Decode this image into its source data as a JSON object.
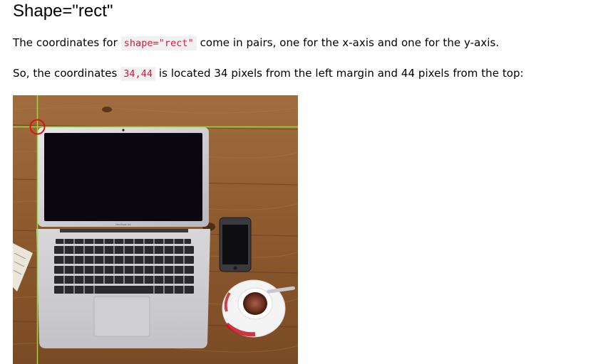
{
  "heading": "Shape=\"rect\"",
  "paragraph1": {
    "before": "The coordinates for ",
    "code": "shape=\"rect\"",
    "after": " come in pairs, one for the x-axis and one for the y-axis."
  },
  "paragraph2": {
    "before": "So, the coordinates ",
    "code": "34,44",
    "after": " is located 34 pixels from the left margin and 44 pixels from the top:"
  },
  "image": {
    "laptop_brand": "MacBook Air",
    "guide_color": "#9ad93a",
    "marker_color": "#e01010"
  }
}
